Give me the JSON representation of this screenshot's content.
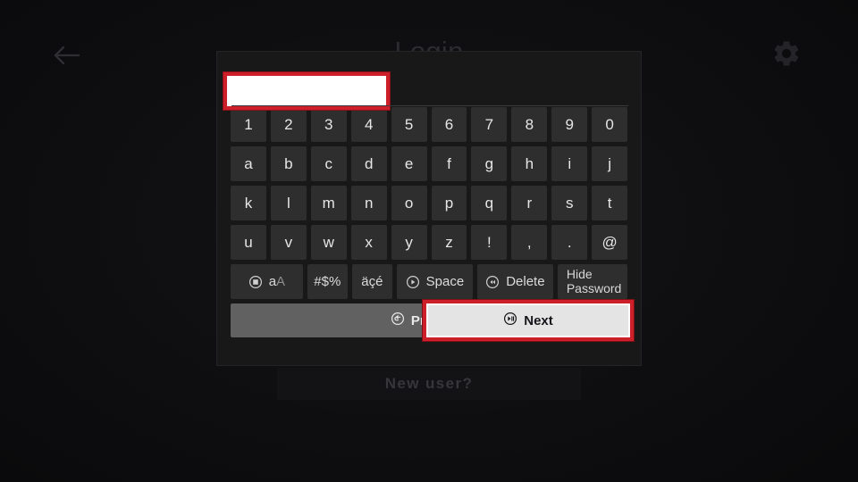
{
  "screen": {
    "title": "Login",
    "back_icon": "back-arrow-icon",
    "settings_icon": "gear-icon",
    "new_user_label": "New user?"
  },
  "colors": {
    "focus_highlight": "#cc1f2a",
    "dialog_bg": "#181818",
    "key_bg": "#2e2e2e",
    "key_text": "#e6e6e6",
    "previous_bg": "#616161",
    "next_bg": "#e4e4e4",
    "page_bg": "#0b0b0d"
  },
  "dialog": {
    "password_input": {
      "value": "",
      "placeholder": "",
      "focused": true,
      "masked": true
    },
    "keyboard_rows": [
      [
        "1",
        "2",
        "3",
        "4",
        "5",
        "6",
        "7",
        "8",
        "9",
        "0"
      ],
      [
        "a",
        "b",
        "c",
        "d",
        "e",
        "f",
        "g",
        "h",
        "i",
        "j"
      ],
      [
        "k",
        "l",
        "m",
        "n",
        "o",
        "p",
        "q",
        "r",
        "s",
        "t"
      ],
      [
        "u",
        "v",
        "w",
        "x",
        "y",
        "z",
        "!",
        ",",
        ".",
        "@"
      ]
    ],
    "function_row": [
      {
        "name": "shift-key",
        "icon": "circle-square-icon",
        "label_primary": "a",
        "label_secondary": "A",
        "kind": "shift"
      },
      {
        "name": "symbols-key",
        "icon": "",
        "label": "#$%",
        "kind": "narrow"
      },
      {
        "name": "accents-key",
        "icon": "",
        "label": "äçé",
        "kind": "narrow"
      },
      {
        "name": "space-key",
        "icon": "circle-play-icon",
        "label": "Space",
        "kind": "space"
      },
      {
        "name": "delete-key",
        "icon": "circle-rewind-icon",
        "label": "Delete",
        "kind": "delete"
      },
      {
        "name": "hide-password-key",
        "icon": "",
        "label_line1": "Hide",
        "label_line2": "Password",
        "kind": "hidepw"
      }
    ],
    "nav": {
      "previous": {
        "label": "Previous",
        "icon": "circle-back-arrow-icon",
        "focused": false
      },
      "next": {
        "label": "Next",
        "icon": "circle-play-pause-icon",
        "focused": true
      }
    }
  }
}
